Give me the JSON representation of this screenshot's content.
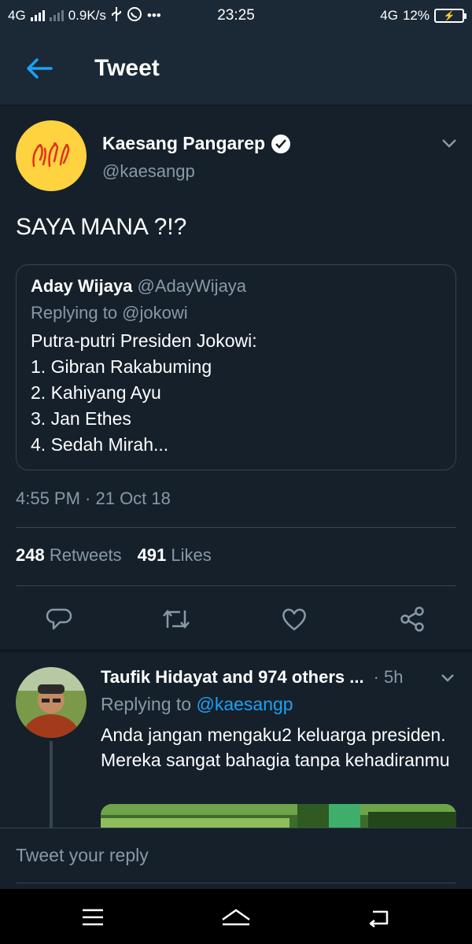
{
  "status_bar": {
    "network_left": "4G",
    "speed": "0.9K/s",
    "time": "23:25",
    "network_right": "4G",
    "battery": "12%"
  },
  "header": {
    "title": "Tweet"
  },
  "tweet": {
    "author_name": "Kaesang Pangarep",
    "author_handle": "@kaesangp",
    "text": "SAYA MANA ?!?",
    "quote": {
      "name": "Aday Wijaya",
      "handle": "@AdayWijaya",
      "replying": "Replying to @jokowi",
      "lines": [
        "Putra-putri Presiden Jokowi:",
        "1. Gibran Rakabuming",
        "2. Kahiyang Ayu",
        "3. Jan Ethes",
        "4. Sedah Mirah..."
      ]
    },
    "timestamp": "4:55 PM · 21 Oct 18",
    "retweets_count": "248",
    "retweets_label": "Retweets",
    "likes_count": "491",
    "likes_label": "Likes"
  },
  "reply": {
    "name": "Taufik Hidayat and 974 others ...",
    "time": "· 5h",
    "replying_prefix": "Replying to",
    "replying_handle": "@kaesangp",
    "text": "Anda jangan mengaku2 keluarga presiden. Mereka sangat bahagia tanpa kehadiranmu"
  },
  "compose": {
    "placeholder": "Tweet your reply"
  },
  "colors": {
    "background": "#15202b",
    "header": "#1b2836",
    "accent": "#1da1f2",
    "muted": "#8899a6",
    "border": "#38444d"
  },
  "icons": [
    "back-arrow-icon",
    "verified-icon",
    "chevron-down-icon",
    "reply-icon",
    "retweet-icon",
    "like-icon",
    "share-icon",
    "menu-icon",
    "home-icon",
    "back-icon"
  ]
}
